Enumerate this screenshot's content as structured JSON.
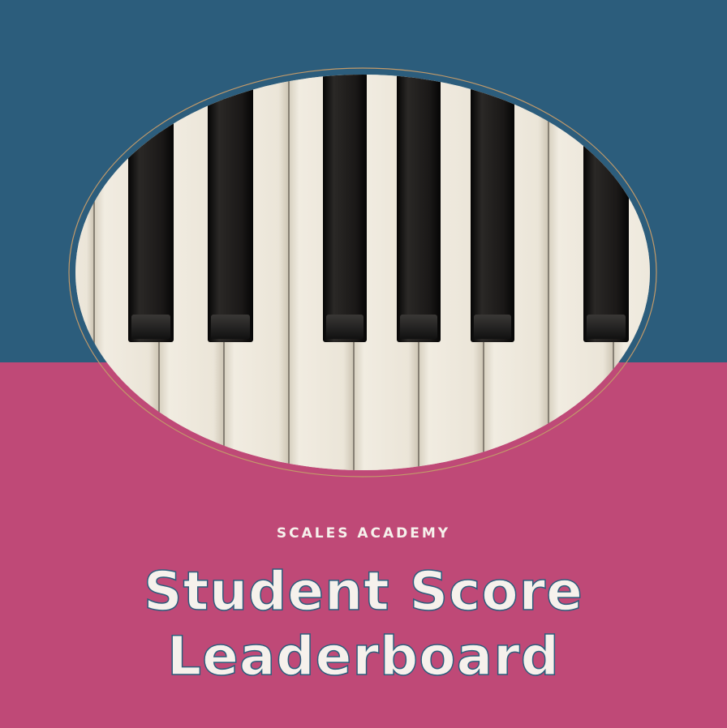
{
  "header": {
    "subtitle": "SCALES ACADEMY",
    "title_line_1": "Student Score",
    "title_line_2": "Leaderboard"
  },
  "image": {
    "description": "piano-keys-photo"
  },
  "colors": {
    "top_background": "#2c5d7c",
    "bottom_background": "#bf4977",
    "title_text": "#f6f1ec",
    "title_outline": "#2c5d7c",
    "oval_outline": "#c29a6a",
    "white_key": "#ece6d8",
    "black_key": "#151312"
  }
}
